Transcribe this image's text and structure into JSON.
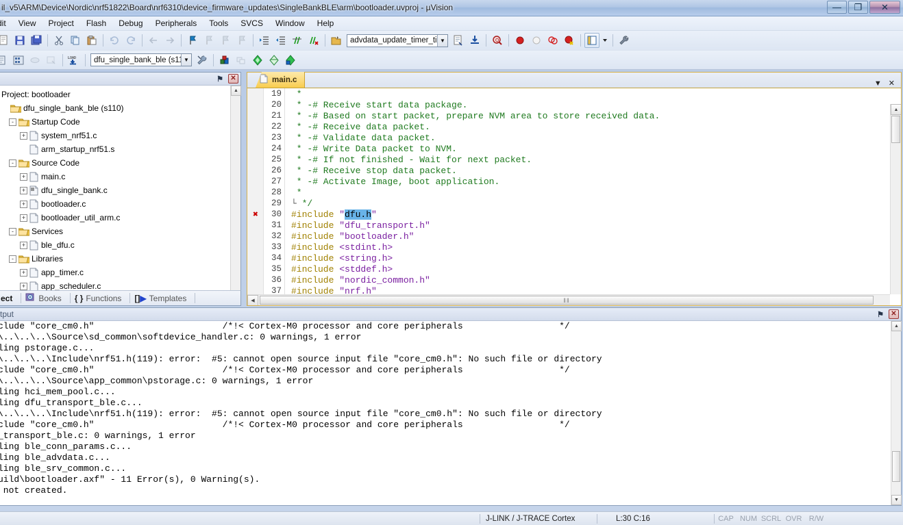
{
  "window": {
    "title": "il_v5\\ARM\\Device\\Nordic\\nrf51822\\Board\\nrf6310\\device_firmware_updates\\SingleBankBLE\\arm\\bootloader.uvproj - µVision",
    "minimize_label": "—",
    "maximize_label": "❐",
    "close_label": "✕"
  },
  "menubar": {
    "items": [
      {
        "label": "dit"
      },
      {
        "label": "View"
      },
      {
        "label": "Project"
      },
      {
        "label": "Flash"
      },
      {
        "label": "Debug"
      },
      {
        "label": "Peripherals"
      },
      {
        "label": "Tools"
      },
      {
        "label": "SVCS"
      },
      {
        "label": "Window"
      },
      {
        "label": "Help"
      }
    ]
  },
  "toolbar1": {
    "target_combo": {
      "value": "advdata_update_timer_ti",
      "arrow": "▼"
    },
    "icons": [
      "new-file-icon",
      "save-icon",
      "save-all-icon",
      "cut-icon",
      "copy-icon",
      "paste-icon",
      "undo-icon",
      "redo-icon",
      "navigate-back-icon",
      "navigate-forward-icon",
      "bookmark-toggle-icon",
      "bookmark-prev-icon",
      "bookmark-next-icon",
      "bookmark-clear-icon",
      "indent-icon",
      "outdent-icon",
      "comment-icon",
      "uncomment-icon",
      "target-options-icon",
      "build-target-icon",
      "download-icon",
      "find-in-files-icon",
      "insert-breakpoint-icon",
      "disable-breakpoint-icon",
      "remove-all-breakpoints-icon",
      "disable-all-breakpoints-icon",
      "project-window-icon",
      "configure-icon"
    ]
  },
  "toolbar2": {
    "project_combo": {
      "value": "dfu_single_bank_ble (s11",
      "arrow": "▼"
    },
    "icons": [
      "translate-icon",
      "build-icon",
      "rebuild-icon",
      "batch-build-icon",
      "load-icon",
      "target-options-icon",
      "manage-components-icon",
      "multi-project-icon",
      "new-item-icon",
      "remove-item-icon",
      "add-item-icon"
    ]
  },
  "project_pane": {
    "caption_pin": "⚑",
    "caption_close": "✕",
    "root_label": "Project: bootloader",
    "tree": [
      {
        "indent": 1,
        "icon": "folder-icon",
        "expander": "",
        "label": "dfu_single_bank_ble (s110)"
      },
      {
        "indent": 2,
        "icon": "folder-icon",
        "expander": "-",
        "label": "Startup Code"
      },
      {
        "indent": 3,
        "icon": "file-icon",
        "expander": "+",
        "label": "system_nrf51.c"
      },
      {
        "indent": 3,
        "icon": "file-icon",
        "expander": "",
        "label": "arm_startup_nrf51.s"
      },
      {
        "indent": 2,
        "icon": "folder-icon",
        "expander": "-",
        "label": "Source Code"
      },
      {
        "indent": 3,
        "icon": "file-icon",
        "expander": "+",
        "label": "main.c"
      },
      {
        "indent": 3,
        "icon": "file-modified-icon",
        "expander": "+",
        "label": "dfu_single_bank.c"
      },
      {
        "indent": 3,
        "icon": "file-icon",
        "expander": "+",
        "label": "bootloader.c"
      },
      {
        "indent": 3,
        "icon": "file-icon",
        "expander": "+",
        "label": "bootloader_util_arm.c"
      },
      {
        "indent": 2,
        "icon": "folder-icon",
        "expander": "-",
        "label": "Services"
      },
      {
        "indent": 3,
        "icon": "file-icon",
        "expander": "+",
        "label": "ble_dfu.c"
      },
      {
        "indent": 2,
        "icon": "folder-icon",
        "expander": "-",
        "label": "Libraries"
      },
      {
        "indent": 3,
        "icon": "file-icon",
        "expander": "+",
        "label": "app_timer.c"
      },
      {
        "indent": 3,
        "icon": "file-icon",
        "expander": "+",
        "label": "app_scheduler.c"
      }
    ],
    "scroll_up": "▲",
    "scroll_down": "▼"
  },
  "project_tabs": {
    "items": [
      {
        "label": "ect",
        "icon": "project-icon"
      },
      {
        "label": "Books",
        "icon": "books-icon"
      },
      {
        "label": "Functions",
        "icon": "functions-icon"
      },
      {
        "label": "Templates",
        "icon": "templates-icon"
      }
    ]
  },
  "editor": {
    "tabs": [
      {
        "label": "main.c",
        "icon": "c-file-icon",
        "active": true
      }
    ],
    "tab_menu_arrow": "▼",
    "tab_close": "✕",
    "hscroll_left_arrow": "◀",
    "hscroll_grip": "‖‖",
    "vscroll_up": "▲",
    "lines": [
      {
        "num": "19",
        "marker": "",
        "segments": [
          {
            "t": " *",
            "c": "c-comment"
          }
        ]
      },
      {
        "num": "20",
        "marker": "",
        "segments": [
          {
            "t": " * -# Receive start data package.",
            "c": "c-comment"
          }
        ]
      },
      {
        "num": "21",
        "marker": "",
        "segments": [
          {
            "t": " * -# Based on start packet, prepare NVM area to store received data.",
            "c": "c-comment"
          }
        ]
      },
      {
        "num": "22",
        "marker": "",
        "segments": [
          {
            "t": " * -# Receive data packet.",
            "c": "c-comment"
          }
        ]
      },
      {
        "num": "23",
        "marker": "",
        "segments": [
          {
            "t": " * -# Validate data packet.",
            "c": "c-comment"
          }
        ]
      },
      {
        "num": "24",
        "marker": "",
        "segments": [
          {
            "t": " * -# Write Data packet to NVM.",
            "c": "c-comment"
          }
        ]
      },
      {
        "num": "25",
        "marker": "",
        "segments": [
          {
            "t": " * -# If not finished - Wait for next packet.",
            "c": "c-comment"
          }
        ]
      },
      {
        "num": "26",
        "marker": "",
        "segments": [
          {
            "t": " * -# Receive stop data packet.",
            "c": "c-comment"
          }
        ]
      },
      {
        "num": "27",
        "marker": "",
        "segments": [
          {
            "t": " * -# Activate Image, boot application.",
            "c": "c-comment"
          }
        ]
      },
      {
        "num": "28",
        "marker": "",
        "segments": [
          {
            "t": " *",
            "c": "c-comment"
          }
        ]
      },
      {
        "num": "29",
        "marker": "",
        "segments": [
          {
            "t": "└",
            "c": "c-brace"
          },
          {
            "t": " */",
            "c": "c-comment"
          }
        ]
      },
      {
        "num": "30",
        "marker": "✖",
        "segments": [
          {
            "t": "#include ",
            "c": "c-pp"
          },
          {
            "t": "\"",
            "c": "c-str"
          },
          {
            "t": "dfu.h",
            "c": "c-sel"
          },
          {
            "t": "\"",
            "c": "c-str"
          }
        ]
      },
      {
        "num": "31",
        "marker": "",
        "segments": [
          {
            "t": "#include ",
            "c": "c-pp"
          },
          {
            "t": "\"dfu_transport.h\"",
            "c": "c-str"
          }
        ]
      },
      {
        "num": "32",
        "marker": "",
        "segments": [
          {
            "t": "#include ",
            "c": "c-pp"
          },
          {
            "t": "\"bootloader.h\"",
            "c": "c-str"
          }
        ]
      },
      {
        "num": "33",
        "marker": "",
        "segments": [
          {
            "t": "#include ",
            "c": "c-pp"
          },
          {
            "t": "<stdint.h>",
            "c": "c-str"
          }
        ]
      },
      {
        "num": "34",
        "marker": "",
        "segments": [
          {
            "t": "#include ",
            "c": "c-pp"
          },
          {
            "t": "<string.h>",
            "c": "c-str"
          }
        ]
      },
      {
        "num": "35",
        "marker": "",
        "segments": [
          {
            "t": "#include ",
            "c": "c-pp"
          },
          {
            "t": "<stddef.h>",
            "c": "c-str"
          }
        ]
      },
      {
        "num": "36",
        "marker": "",
        "segments": [
          {
            "t": "#include ",
            "c": "c-pp"
          },
          {
            "t": "\"nordic_common.h\"",
            "c": "c-str"
          }
        ]
      },
      {
        "num": "37",
        "marker": "",
        "segments": [
          {
            "t": "#include ",
            "c": "c-pp"
          },
          {
            "t": "\"nrf.h\"",
            "c": "c-str"
          }
        ]
      }
    ]
  },
  "output": {
    "title": "tput",
    "caption_pin": "⚑",
    "caption_close": "✕",
    "lines": [
      "clude \"core_cm0.h\"                        /*!< Cortex-M0 processor and core peripherals                  */",
      "\\..\\..\\..\\Source\\sd_common\\softdevice_handler.c: 0 warnings, 1 error",
      "ling pstorage.c...",
      "\\..\\..\\..\\Include\\nrf51.h(119): error:  #5: cannot open source input file \"core_cm0.h\": No such file or directory",
      "clude \"core_cm0.h\"                        /*!< Cortex-M0 processor and core peripherals                  */",
      "\\..\\..\\..\\Source\\app_common\\pstorage.c: 0 warnings, 1 error",
      "ling hci_mem_pool.c...",
      "ling dfu_transport_ble.c...",
      "\\..\\..\\..\\Include\\nrf51.h(119): error:  #5: cannot open source input file \"core_cm0.h\": No such file or directory",
      "clude \"core_cm0.h\"                        /*!< Cortex-M0 processor and core peripherals                  */",
      "_transport_ble.c: 0 warnings, 1 error",
      "ling ble_conn_params.c...",
      "ling ble_advdata.c...",
      "ling ble_srv_common.c...",
      "uild\\bootloader.axf\" - 11 Error(s), 0 Warning(s).",
      " not created."
    ],
    "scroll_up": "▲",
    "scroll_down": "▼"
  },
  "statusbar": {
    "debugger": "J-LINK / J-TRACE Cortex",
    "cursor": "L:30 C:16",
    "flags": [
      "CAP",
      "NUM",
      "SCRL",
      "OVR",
      "R/W"
    ]
  },
  "colors": {
    "tab_active": "#fbd977",
    "error_marker": "#cc0000",
    "comment": "#1f7a1f",
    "preprocessor": "#a08000",
    "string": "#7a1fa0",
    "selection": "#68b3e8"
  }
}
